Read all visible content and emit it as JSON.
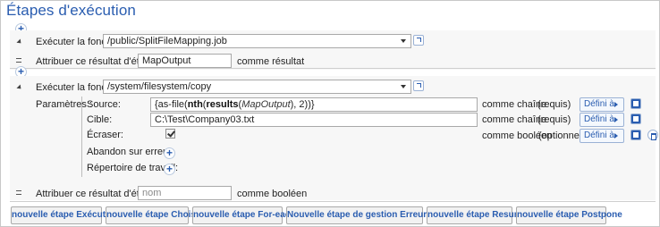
{
  "title": "Étapes d'exécution",
  "step1": {
    "function_label": "Exécuter la fonction",
    "function_value": "/public/SplitFileMapping.job",
    "assign_label": "Attribuer ce résultat d'étape à",
    "assign_value": "MapOutput",
    "assign_suffix": "comme résultat"
  },
  "step2": {
    "function_label": "Exécuter la fonction",
    "function_value": "/system/filesystem/copy",
    "params_label": "Paramètres :",
    "params": [
      {
        "name": "Source:",
        "expr": {
          "open": "{as-file(",
          "fn1": "nth",
          "p1": "(",
          "fn2": "results",
          "p2": "(",
          "arg": "MapOutput",
          "rest": "), 2))}"
        },
        "type": "comme chaîne",
        "required": "(requis)",
        "defined": "Défini à"
      },
      {
        "name": "Cible:",
        "value": "C:\\Test\\Company03.txt",
        "type": "comme chaîne",
        "required": "(requis)",
        "defined": "Défini à"
      },
      {
        "name": "Écraser:",
        "checked": true,
        "type": "comme booléen",
        "required": "(optionnel)",
        "defined": "Défini à"
      },
      {
        "name": "Abandon sur erreur:"
      },
      {
        "name": "Répertoire de travail:"
      }
    ],
    "assign_label": "Attribuer ce résultat d'étape à",
    "assign_placeholder": "nom",
    "assign_suffix": "comme booléen"
  },
  "buttons": [
    "nouvelle étape Exécution",
    "nouvelle étape Choisir",
    "nouvelle étape For-each",
    "Nouvelle étape de gestion Erreur/Succès",
    "nouvelle étape Resume",
    "nouvelle étape Postpone"
  ],
  "icons": {
    "add": "plus-circle-icon",
    "expand": "triangle-expand-icon",
    "drag": "drag-handle-icon",
    "open": "open-external-icon",
    "help": "book-icon",
    "delete": "trash-icon"
  },
  "colors": {
    "accent": "#2a5db0",
    "panel": "#f7f7f7"
  }
}
